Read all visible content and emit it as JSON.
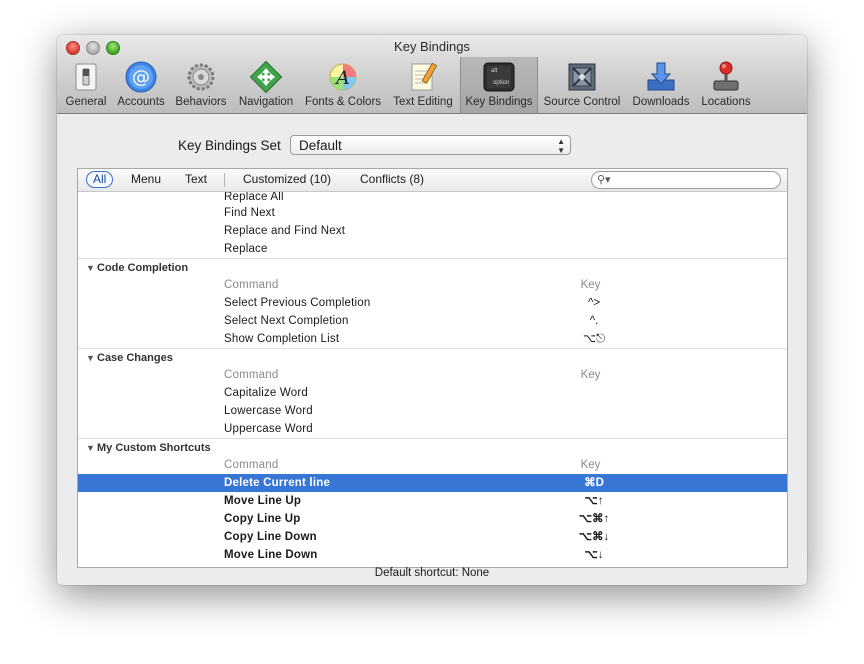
{
  "window": {
    "title": "Key Bindings"
  },
  "toolbar": {
    "items": [
      {
        "label": "General",
        "icon": "general-switch-icon"
      },
      {
        "label": "Accounts",
        "icon": "at-sign-icon"
      },
      {
        "label": "Behaviors",
        "icon": "gears-icon"
      },
      {
        "label": "Navigation",
        "icon": "navigation-arrows-icon"
      },
      {
        "label": "Fonts & Colors",
        "icon": "font-color-icon"
      },
      {
        "label": "Text Editing",
        "icon": "notepad-pencil-icon"
      },
      {
        "label": "Key Bindings",
        "icon": "alt-option-keys-icon",
        "selected": true
      },
      {
        "label": "Source Control",
        "icon": "source-control-box-icon"
      },
      {
        "label": "Downloads",
        "icon": "download-arrow-icon"
      },
      {
        "label": "Locations",
        "icon": "joystick-icon"
      }
    ],
    "key_bindings_icon_text": {
      "top": "alt",
      "bottom": "option"
    }
  },
  "bindings_set": {
    "label": "Key Bindings Set",
    "value": "Default"
  },
  "filters": {
    "all": "All",
    "menu": "Menu",
    "text": "Text",
    "customized": "Customized (10)",
    "conflicts": "Conflicts (8)"
  },
  "search": {
    "placeholder": ""
  },
  "columns": {
    "command": "Command",
    "key": "Key"
  },
  "top_items": [
    "Replace All",
    "Find Next",
    "Replace and Find Next",
    "Replace"
  ],
  "groups": [
    {
      "name": "Code Completion",
      "rows": [
        {
          "command": "Select Previous Completion",
          "key": "^>"
        },
        {
          "command": "Select Next Completion",
          "key": "^."
        },
        {
          "command": "Show Completion List",
          "key": "⌥⎋"
        }
      ]
    },
    {
      "name": "Case Changes",
      "rows": [
        {
          "command": "Capitalize Word",
          "key": ""
        },
        {
          "command": "Lowercase Word",
          "key": ""
        },
        {
          "command": "Uppercase Word",
          "key": ""
        }
      ]
    },
    {
      "name": "My Custom Shortcuts",
      "rows": [
        {
          "command": "Delete Current line",
          "key": "⌘D",
          "selected": true
        },
        {
          "command": "Move Line Up",
          "key": "⌥↑"
        },
        {
          "command": "Copy Line Up",
          "key": "⌥⌘↑"
        },
        {
          "command": "Copy Line Down",
          "key": "⌥⌘↓"
        },
        {
          "command": "Move Line Down",
          "key": "⌥↓"
        }
      ]
    }
  ],
  "status": "Default shortcut: None"
}
